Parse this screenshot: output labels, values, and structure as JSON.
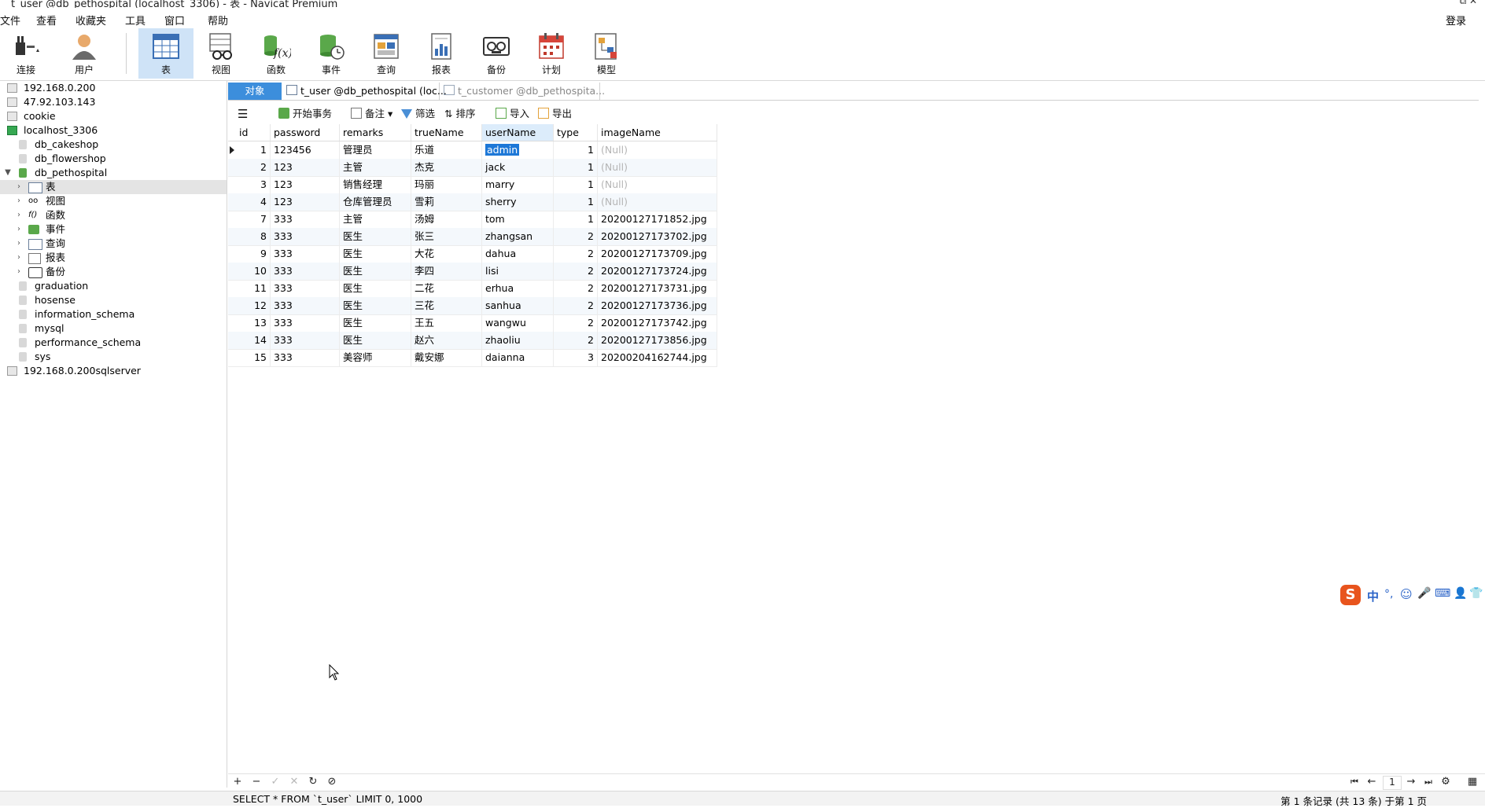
{
  "window": {
    "title": "t_user @db_pethospital (localhost_3306) - 表 - Navicat Premium"
  },
  "menu": {
    "items": [
      "文件",
      "查看",
      "收藏夹",
      "工具",
      "窗口",
      "帮助"
    ],
    "login": "登录"
  },
  "toolbar": {
    "buttons": [
      {
        "label": "连接",
        "icon": "plug-icon"
      },
      {
        "label": "用户",
        "icon": "user-icon"
      },
      {
        "label": "表",
        "icon": "table-icon"
      },
      {
        "label": "视图",
        "icon": "view-icon"
      },
      {
        "label": "函数",
        "icon": "function-icon"
      },
      {
        "label": "事件",
        "icon": "event-icon"
      },
      {
        "label": "查询",
        "icon": "query-icon"
      },
      {
        "label": "报表",
        "icon": "report-icon"
      },
      {
        "label": "备份",
        "icon": "backup-icon"
      },
      {
        "label": "计划",
        "icon": "schedule-icon"
      },
      {
        "label": "模型",
        "icon": "model-icon"
      }
    ],
    "selected": "表"
  },
  "sidebar": {
    "connections": [
      {
        "label": "192.168.0.200"
      },
      {
        "label": "47.92.103.143"
      },
      {
        "label": "cookie"
      },
      {
        "label": "localhost_3306"
      }
    ],
    "databases": [
      {
        "label": "db_cakeshop"
      },
      {
        "label": "db_flowershop"
      },
      {
        "label": "db_pethospital"
      }
    ],
    "db_children": [
      {
        "label": "表"
      },
      {
        "label": "视图"
      },
      {
        "label": "函数"
      },
      {
        "label": "事件"
      },
      {
        "label": "查询"
      },
      {
        "label": "报表"
      },
      {
        "label": "备份"
      }
    ],
    "other_dbs": [
      {
        "label": "graduation"
      },
      {
        "label": "hosense"
      },
      {
        "label": "information_schema"
      },
      {
        "label": "mysql"
      },
      {
        "label": "performance_schema"
      },
      {
        "label": "sys"
      }
    ],
    "last_connection": {
      "label": "192.168.0.200sqlserver"
    }
  },
  "tabs": {
    "object": "对象",
    "docs": [
      "t_user @db_pethospital (loc...",
      "t_customer @db_pethospita..."
    ]
  },
  "objtoolbar": {
    "begin_tx": "开始事务",
    "memo": "备注",
    "filter": "筛选",
    "sort": "排序",
    "import": "导入",
    "export": "导出"
  },
  "grid": {
    "columns": [
      "id",
      "password",
      "remarks",
      "trueName",
      "userName",
      "type",
      "imageName"
    ],
    "null_text": "(Null)",
    "rows": [
      [
        "1",
        "123456",
        "管理员",
        "乐道",
        "admin",
        "1",
        null
      ],
      [
        "2",
        "123",
        "主管",
        "杰克",
        "jack",
        "1",
        null
      ],
      [
        "3",
        "123",
        "销售经理",
        "玛丽",
        "marry",
        "1",
        null
      ],
      [
        "4",
        "123",
        "仓库管理员",
        "雪莉",
        "sherry",
        "1",
        null
      ],
      [
        "7",
        "333",
        "主管",
        "汤姆",
        "tom",
        "1",
        "20200127171852.jpg"
      ],
      [
        "8",
        "333",
        "医生",
        "张三",
        "zhangsan",
        "2",
        "20200127173702.jpg"
      ],
      [
        "9",
        "333",
        "医生",
        "大花",
        "dahua",
        "2",
        "20200127173709.jpg"
      ],
      [
        "10",
        "333",
        "医生",
        "李四",
        "lisi",
        "2",
        "20200127173724.jpg"
      ],
      [
        "11",
        "333",
        "医生",
        "二花",
        "erhua",
        "2",
        "20200127173731.jpg"
      ],
      [
        "12",
        "333",
        "医生",
        "三花",
        "sanhua",
        "2",
        "20200127173736.jpg"
      ],
      [
        "13",
        "333",
        "医生",
        "王五",
        "wangwu",
        "2",
        "20200127173742.jpg"
      ],
      [
        "14",
        "333",
        "医生",
        "赵六",
        "zhaoliu",
        "2",
        "20200127173856.jpg"
      ],
      [
        "15",
        "333",
        "美容师",
        "戴安娜",
        "daianna",
        "3",
        "20200204162744.jpg"
      ]
    ]
  },
  "pager": {
    "page": "1"
  },
  "status": {
    "sql": "SELECT * FROM `t_user` LIMIT 0, 1000",
    "records": "第 1 条记录 (共 13 条) 于第 1 页"
  },
  "ime": {
    "label": "中"
  },
  "colors": {
    "accent": "#3c8edc",
    "selection": "#1e78d7",
    "null_text": "#b5b5b5"
  }
}
